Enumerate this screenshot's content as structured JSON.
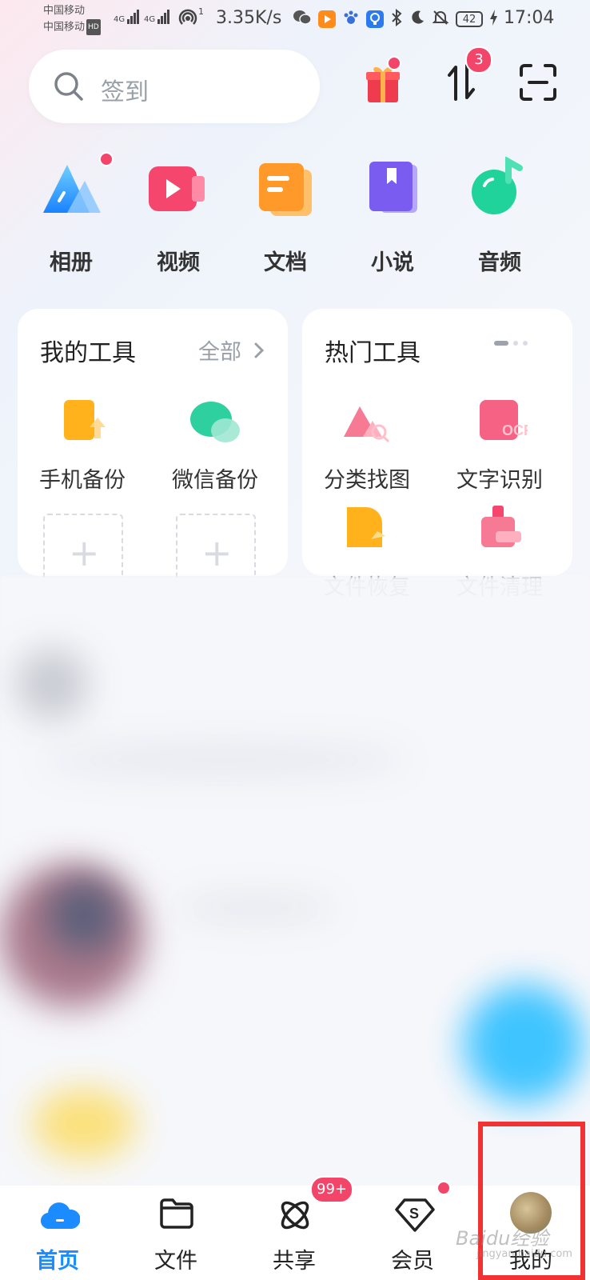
{
  "status_bar": {
    "carrier_1": "中国移动",
    "carrier_2": "中国移动",
    "hd": "HD",
    "net_1": "4G",
    "net_2": "4G",
    "hotspot_sup": "1",
    "speed": "3.35K/s",
    "battery": "42",
    "time": "17:04"
  },
  "header": {
    "search_placeholder": "签到",
    "transfer_badge": "3"
  },
  "categories": [
    {
      "label": "相册",
      "icon": "album-icon",
      "color": "#3aa0ff"
    },
    {
      "label": "视频",
      "icon": "video-icon",
      "color": "#f5466e"
    },
    {
      "label": "文档",
      "icon": "document-icon",
      "color": "#ff9a2a"
    },
    {
      "label": "小说",
      "icon": "novel-icon",
      "color": "#7a5cf0"
    },
    {
      "label": "音频",
      "icon": "audio-icon",
      "color": "#1fd39a"
    }
  ],
  "my_tools": {
    "title": "我的工具",
    "all_label": "全部",
    "items": [
      {
        "label": "手机备份",
        "icon": "phone-backup-icon"
      },
      {
        "label": "微信备份",
        "icon": "wechat-backup-icon"
      }
    ]
  },
  "hot_tools": {
    "title": "热门工具",
    "items": [
      {
        "label": "分类找图",
        "icon": "find-image-icon"
      },
      {
        "label": "文字识别",
        "icon": "ocr-icon",
        "icon_text": "OCR"
      },
      {
        "label": "文件恢复",
        "icon": "file-recovery-icon"
      },
      {
        "label": "文件清理",
        "icon": "file-cleanup-icon"
      }
    ]
  },
  "bottom_nav": [
    {
      "label": "首页",
      "icon": "home-cloud-icon",
      "active": true
    },
    {
      "label": "文件",
      "icon": "folder-icon"
    },
    {
      "label": "共享",
      "icon": "share-icon",
      "badge": "99+"
    },
    {
      "label": "会员",
      "icon": "vip-icon"
    },
    {
      "label": "我的",
      "icon": "avatar"
    }
  ],
  "colors": {
    "accent": "#1a8cff",
    "badge_red": "#f3456a",
    "highlight_red": "#f03232"
  },
  "watermark": {
    "text": "Baidu经验",
    "sub": "jingyan.baidu.com"
  }
}
